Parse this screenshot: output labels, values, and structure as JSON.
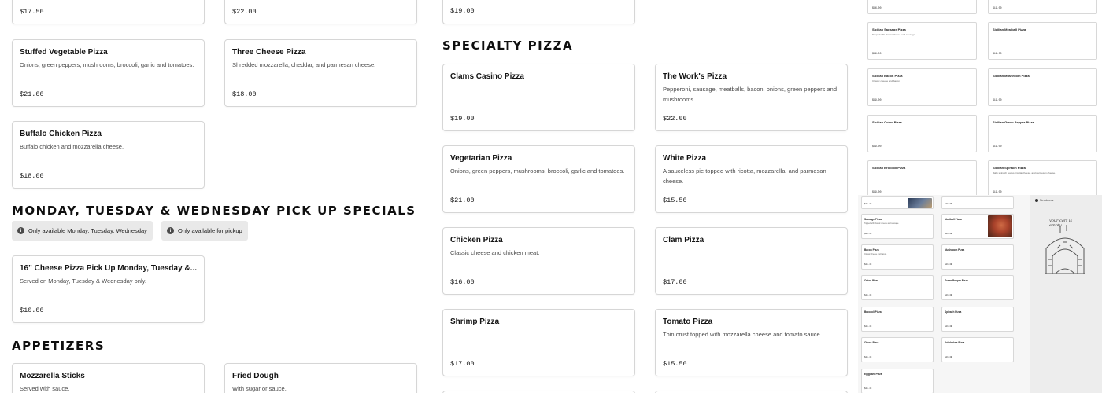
{
  "top_row": {
    "left_price": "$17.50",
    "mid_price": "$22.00",
    "right_price": "$19.00"
  },
  "pizza_cards": [
    {
      "title": "Stuffed Vegetable Pizza",
      "desc": "Onions, green peppers, mushrooms, broccoli, garlic and tomatoes.",
      "price": "$21.00"
    },
    {
      "title": "Three Cheese Pizza",
      "desc": "Shredded mozzarella, cheddar, and parmesan cheese.",
      "price": "$18.00"
    },
    {
      "title": "Buffalo Chicken Pizza",
      "desc": "Buffalo chicken and mozzarella cheese.",
      "price": "$18.00"
    }
  ],
  "specials": {
    "heading": "monday, tuesday & wednesday pick up specials",
    "pills": [
      "Only available Monday, Tuesday, Wednesday",
      "Only available for pickup"
    ],
    "card": {
      "title": "16\" Cheese Pizza Pick Up Monday, Tuesday &...",
      "desc": "Served on Monday, Tuesday & Wednesday only.",
      "price": "$10.00"
    }
  },
  "appetizers": {
    "heading": "appetizers",
    "cards": [
      {
        "title": "Mozzarella Sticks",
        "desc": "Served with sauce."
      },
      {
        "title": "Fried Dough",
        "desc": "With sugar or sauce."
      }
    ]
  },
  "specialty": {
    "heading": "specialty pizza",
    "cards": [
      {
        "title": "Clams Casino Pizza",
        "desc": "",
        "price": "$19.00"
      },
      {
        "title": "The Work's Pizza",
        "desc": "Pepperoni, sausage, meatballs, bacon, onions, green peppers and mushrooms.",
        "price": "$22.00"
      },
      {
        "title": "Vegetarian Pizza",
        "desc": "Onions, green peppers, mushrooms, broccoli, garlic and tomatoes.",
        "price": "$21.00"
      },
      {
        "title": "White Pizza",
        "desc": "A sauceless pie topped with ricotta, mozzarella, and parmesan cheese.",
        "price": "$15.50"
      },
      {
        "title": "Chicken Pizza",
        "desc": "Classic cheese and chicken meat.",
        "price": "$16.00"
      },
      {
        "title": "Clam Pizza",
        "desc": "",
        "price": "$17.00"
      },
      {
        "title": "Shrimp Pizza",
        "desc": "",
        "price": "$17.00"
      },
      {
        "title": "Tomato Pizza",
        "desc": "Thin crust topped with mozzarella cheese and tomato sauce.",
        "price": "$15.50"
      }
    ]
  },
  "preview_top": {
    "prices": [
      "$16.00",
      "$19.00"
    ],
    "cards": [
      {
        "title": "Sicilian Sausage Pizza",
        "desc": "Topped with classic cheese and sausage.",
        "price": "$19.00"
      },
      {
        "title": "Sicilian Meatball Pizza",
        "desc": "",
        "price": "$19.00"
      },
      {
        "title": "Sicilian Bacon Pizza",
        "desc": "Classic cheese and bacon.",
        "price": "$19.00"
      },
      {
        "title": "Sicilian Mushroom Pizza",
        "desc": "",
        "price": "$19.00"
      },
      {
        "title": "Sicilian Onion Pizza",
        "desc": "",
        "price": "$19.00"
      },
      {
        "title": "Sicilian Green Pepper Pizza",
        "desc": "",
        "price": "$19.00"
      },
      {
        "title": "Sicilian Broccoli Pizza",
        "desc": "",
        "price": "$19.00"
      },
      {
        "title": "Sicilian Spinach Pizza",
        "desc": "Baby spinach leaves, ricotta cheese, and parmesan cheese.",
        "price": "$19.00"
      }
    ]
  },
  "preview_bottom": {
    "cards": [
      {
        "title": "",
        "desc": "",
        "price": "$21.49"
      },
      {
        "title": "",
        "desc": "",
        "price": "$21.49"
      },
      {
        "title": "Sausage Pizza",
        "desc": "Topped with classic cheese and sausage.",
        "price": "$21.49"
      },
      {
        "title": "Meatball Pizza",
        "desc": "",
        "price": "$21.49"
      },
      {
        "title": "Bacon Pizza",
        "desc": "Classic cheese and bacon.",
        "price": "$21.49"
      },
      {
        "title": "Mushroom Pizza",
        "desc": "",
        "price": "$21.49"
      },
      {
        "title": "Onion Pizza",
        "desc": "",
        "price": "$21.49"
      },
      {
        "title": "Green Pepper Pizza",
        "desc": "",
        "price": "$21.49"
      },
      {
        "title": "Broccoli Pizza",
        "desc": "",
        "price": "$21.49"
      },
      {
        "title": "Spinach Pizza",
        "desc": "",
        "price": "$21.49"
      },
      {
        "title": "Olives Pizza",
        "desc": "",
        "price": "$21.49"
      },
      {
        "title": "Artichokes Pizza",
        "desc": "",
        "price": "$21.49"
      },
      {
        "title": "Eggplant Pizza",
        "desc": "",
        "price": "$21.49"
      }
    ],
    "cart": {
      "address": "No address",
      "msg": "your cart is empty"
    }
  }
}
